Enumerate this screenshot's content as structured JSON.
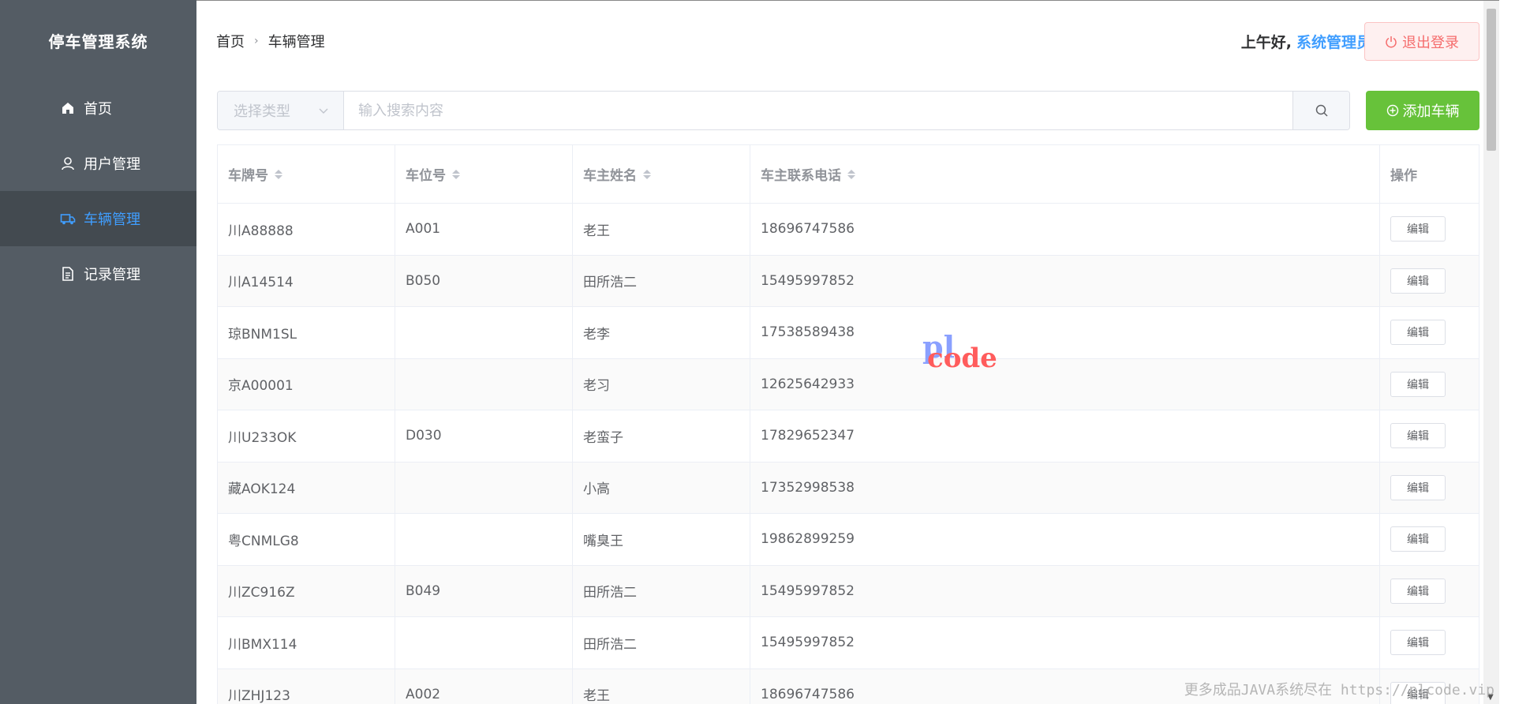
{
  "sidebar": {
    "brand": "停车管理系统",
    "items": [
      {
        "label": "首页",
        "icon": "home-icon",
        "active": false
      },
      {
        "label": "用户管理",
        "icon": "user-icon",
        "active": false
      },
      {
        "label": "车辆管理",
        "icon": "truck-icon",
        "active": true
      },
      {
        "label": "记录管理",
        "icon": "document-icon",
        "active": false
      }
    ]
  },
  "header": {
    "breadcrumb": [
      "首页",
      "车辆管理"
    ],
    "greeting": "上午好,",
    "username": "系统管理员",
    "logout_label": "退出登录"
  },
  "search": {
    "type_placeholder": "选择类型",
    "placeholder": "输入搜索内容",
    "add_label": "添加车辆"
  },
  "table": {
    "columns": [
      "车牌号",
      "车位号",
      "车主姓名",
      "车主联系电话",
      "操作"
    ],
    "edit_label": "编辑",
    "rows": [
      [
        "川A88888",
        "A001",
        "老王",
        "18696747586"
      ],
      [
        "川A14514",
        "B050",
        "田所浩二",
        "15495997852"
      ],
      [
        "琼BNM1SL",
        "",
        "老李",
        "17538589438"
      ],
      [
        "京A00001",
        "",
        "老习",
        "12625642933"
      ],
      [
        "川U233OK",
        "D030",
        "老蛮子",
        "17829652347"
      ],
      [
        "藏AOK124",
        "",
        "小高",
        "17352998538"
      ],
      [
        "粤CNMLG8",
        "",
        "嘴臭王",
        "19862899259"
      ],
      [
        "川ZC916Z",
        "B049",
        "田所浩二",
        "15495997852"
      ],
      [
        "川BMX114",
        "",
        "田所浩二",
        "15495997852"
      ],
      [
        "川ZHJ123",
        "A002",
        "老王",
        "18696747586"
      ]
    ]
  },
  "watermark": {
    "logo_top": "pl",
    "logo_bottom": "code",
    "footer": "更多成品JAVA系统尽在 https://plcode.vip"
  },
  "colors": {
    "sidebar_bg": "#545c64",
    "active": "#409eff",
    "success": "#67c23a",
    "danger": "#f56c6c"
  }
}
